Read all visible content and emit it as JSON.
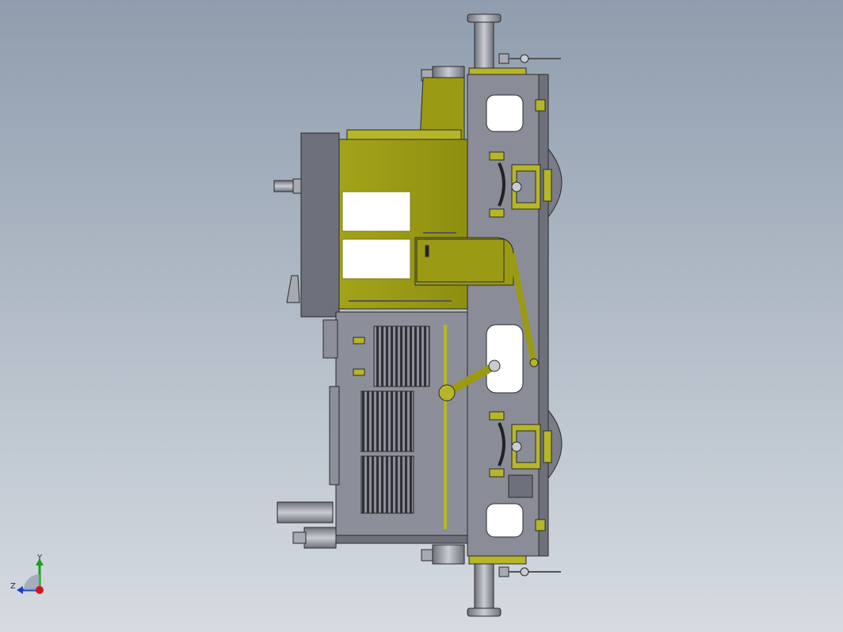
{
  "viewport": {
    "background_top": "#8f9dae",
    "background_bottom": "#d6dbe1"
  },
  "model": {
    "colors": {
      "frame": "#8a8d97",
      "frame_dark": "#6e717b",
      "cab": "#9a9a14",
      "cab_light": "#b6b628",
      "cab_dark": "#7a7a0c",
      "window": "#ffffff",
      "outline": "#2a2a2a",
      "hood": "#8c8f99",
      "grille": "#2f3136",
      "wheel": "#7a7d86",
      "metal": "#a7aab2",
      "metal_light": "#c8cbd2"
    }
  },
  "triad": {
    "y_label": "Y",
    "z_label": "Z",
    "colors": {
      "y": "#1aa01a",
      "z": "#2040c0",
      "x": "#d01818"
    }
  }
}
